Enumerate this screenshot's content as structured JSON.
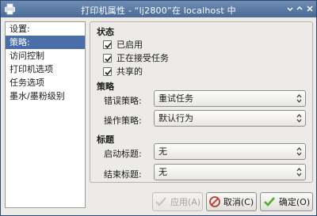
{
  "window": {
    "title": "打印机属性 - “lj2800”在 localhost 中"
  },
  "sidebar": {
    "items": [
      {
        "label": "设置:"
      },
      {
        "label": "策略:",
        "selected": true
      },
      {
        "label": "访问控制"
      },
      {
        "label": "打印机选项"
      },
      {
        "label": "任务选项"
      },
      {
        "label": "墨水/墨粉级别"
      }
    ]
  },
  "policies": {
    "state_title": "状态",
    "enabled_label": "已启用",
    "enabled_checked": true,
    "accepting_label": "正在接受任务",
    "accepting_checked": true,
    "shared_label": "共享的",
    "shared_checked": true,
    "policy_title": "策略",
    "error_policy_label": "错误策略:",
    "error_policy_value": "重试任务",
    "operation_policy_label": "操作策略:",
    "operation_policy_value": "默认行为",
    "banner_title": "标题",
    "start_banner_label": "启动标题:",
    "start_banner_value": "无",
    "end_banner_label": "结束标题:",
    "end_banner_value": "无"
  },
  "buttons": {
    "apply_label": "应用(A)",
    "cancel_label": "取消(C)",
    "ok_label": "确定(O)"
  },
  "colors": {
    "titlebar": "#4a6a95",
    "selection": "#4a6ea8",
    "ok_check": "#4caf2a",
    "cancel_icon": "#c0392b"
  }
}
